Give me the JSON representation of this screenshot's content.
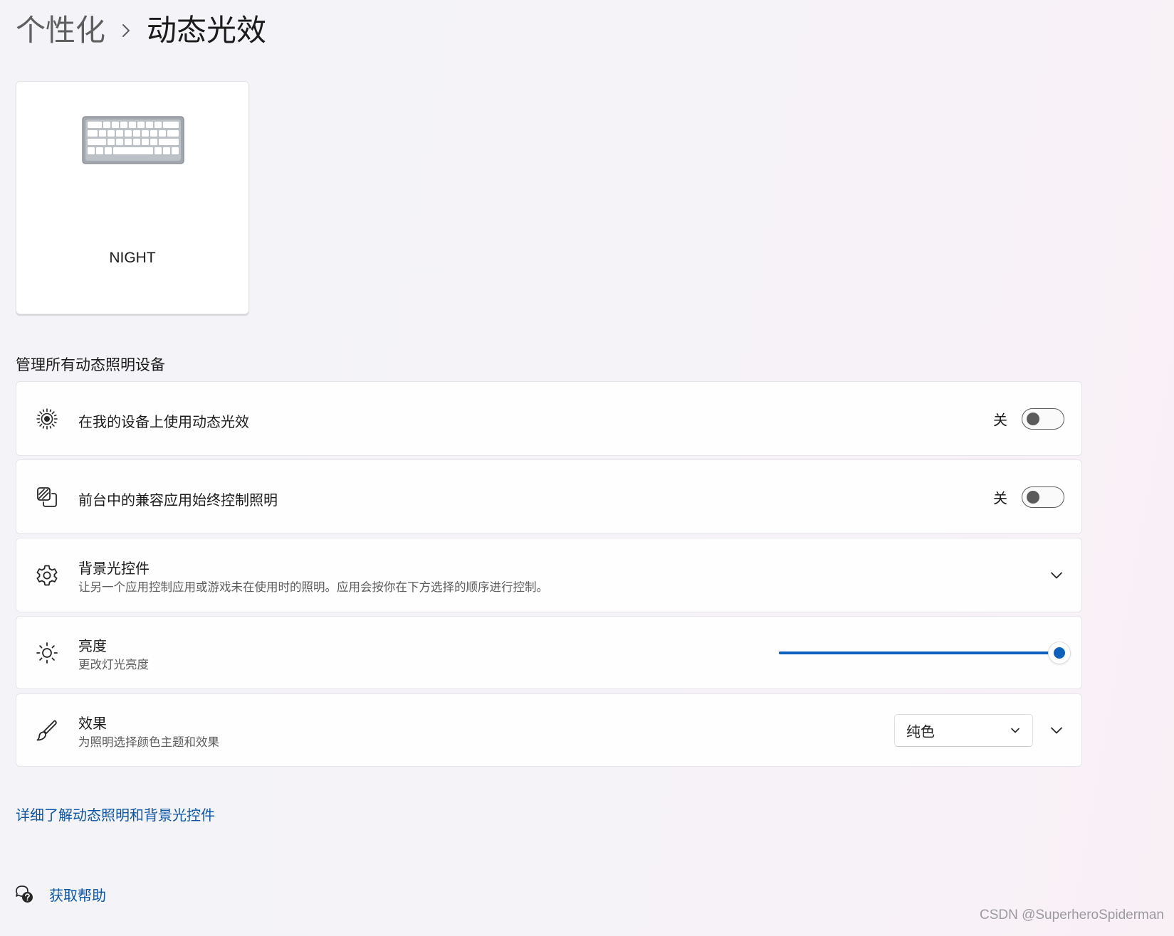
{
  "breadcrumb": {
    "parent": "个性化",
    "separator": "›",
    "current": "动态光效"
  },
  "device": {
    "name": "NIGHT",
    "icon": "keyboard-icon"
  },
  "section": {
    "title": "管理所有动态照明设备"
  },
  "settings": {
    "use_lighting": {
      "icon": "lighting-icon",
      "title": "在我的设备上使用动态光效",
      "state_label": "关",
      "on": false
    },
    "foreground_apps": {
      "icon": "apps-control-icon",
      "title": "前台中的兼容应用始终控制照明",
      "state_label": "关",
      "on": false
    },
    "background_controls": {
      "icon": "gear-icon",
      "title": "背景光控件",
      "subtitle": "让另一个应用控制应用或游戏未在使用时的照明。应用会按你在下方选择的顺序进行控制。"
    },
    "brightness": {
      "icon": "sun-icon",
      "title": "亮度",
      "subtitle": "更改灯光亮度",
      "level_percent": 100
    },
    "effects": {
      "icon": "brush-icon",
      "title": "效果",
      "subtitle": "为照明选择颜色主题和效果",
      "selected": "纯色"
    }
  },
  "links": {
    "learn_more": "详细了解动态照明和背景光控件",
    "get_help": "获取帮助"
  },
  "watermark": "CSDN @SuperheroSpiderman",
  "colors": {
    "accent": "#0d60bd",
    "link": "#0b56a8",
    "toggle_off": "#5b5b5b"
  }
}
